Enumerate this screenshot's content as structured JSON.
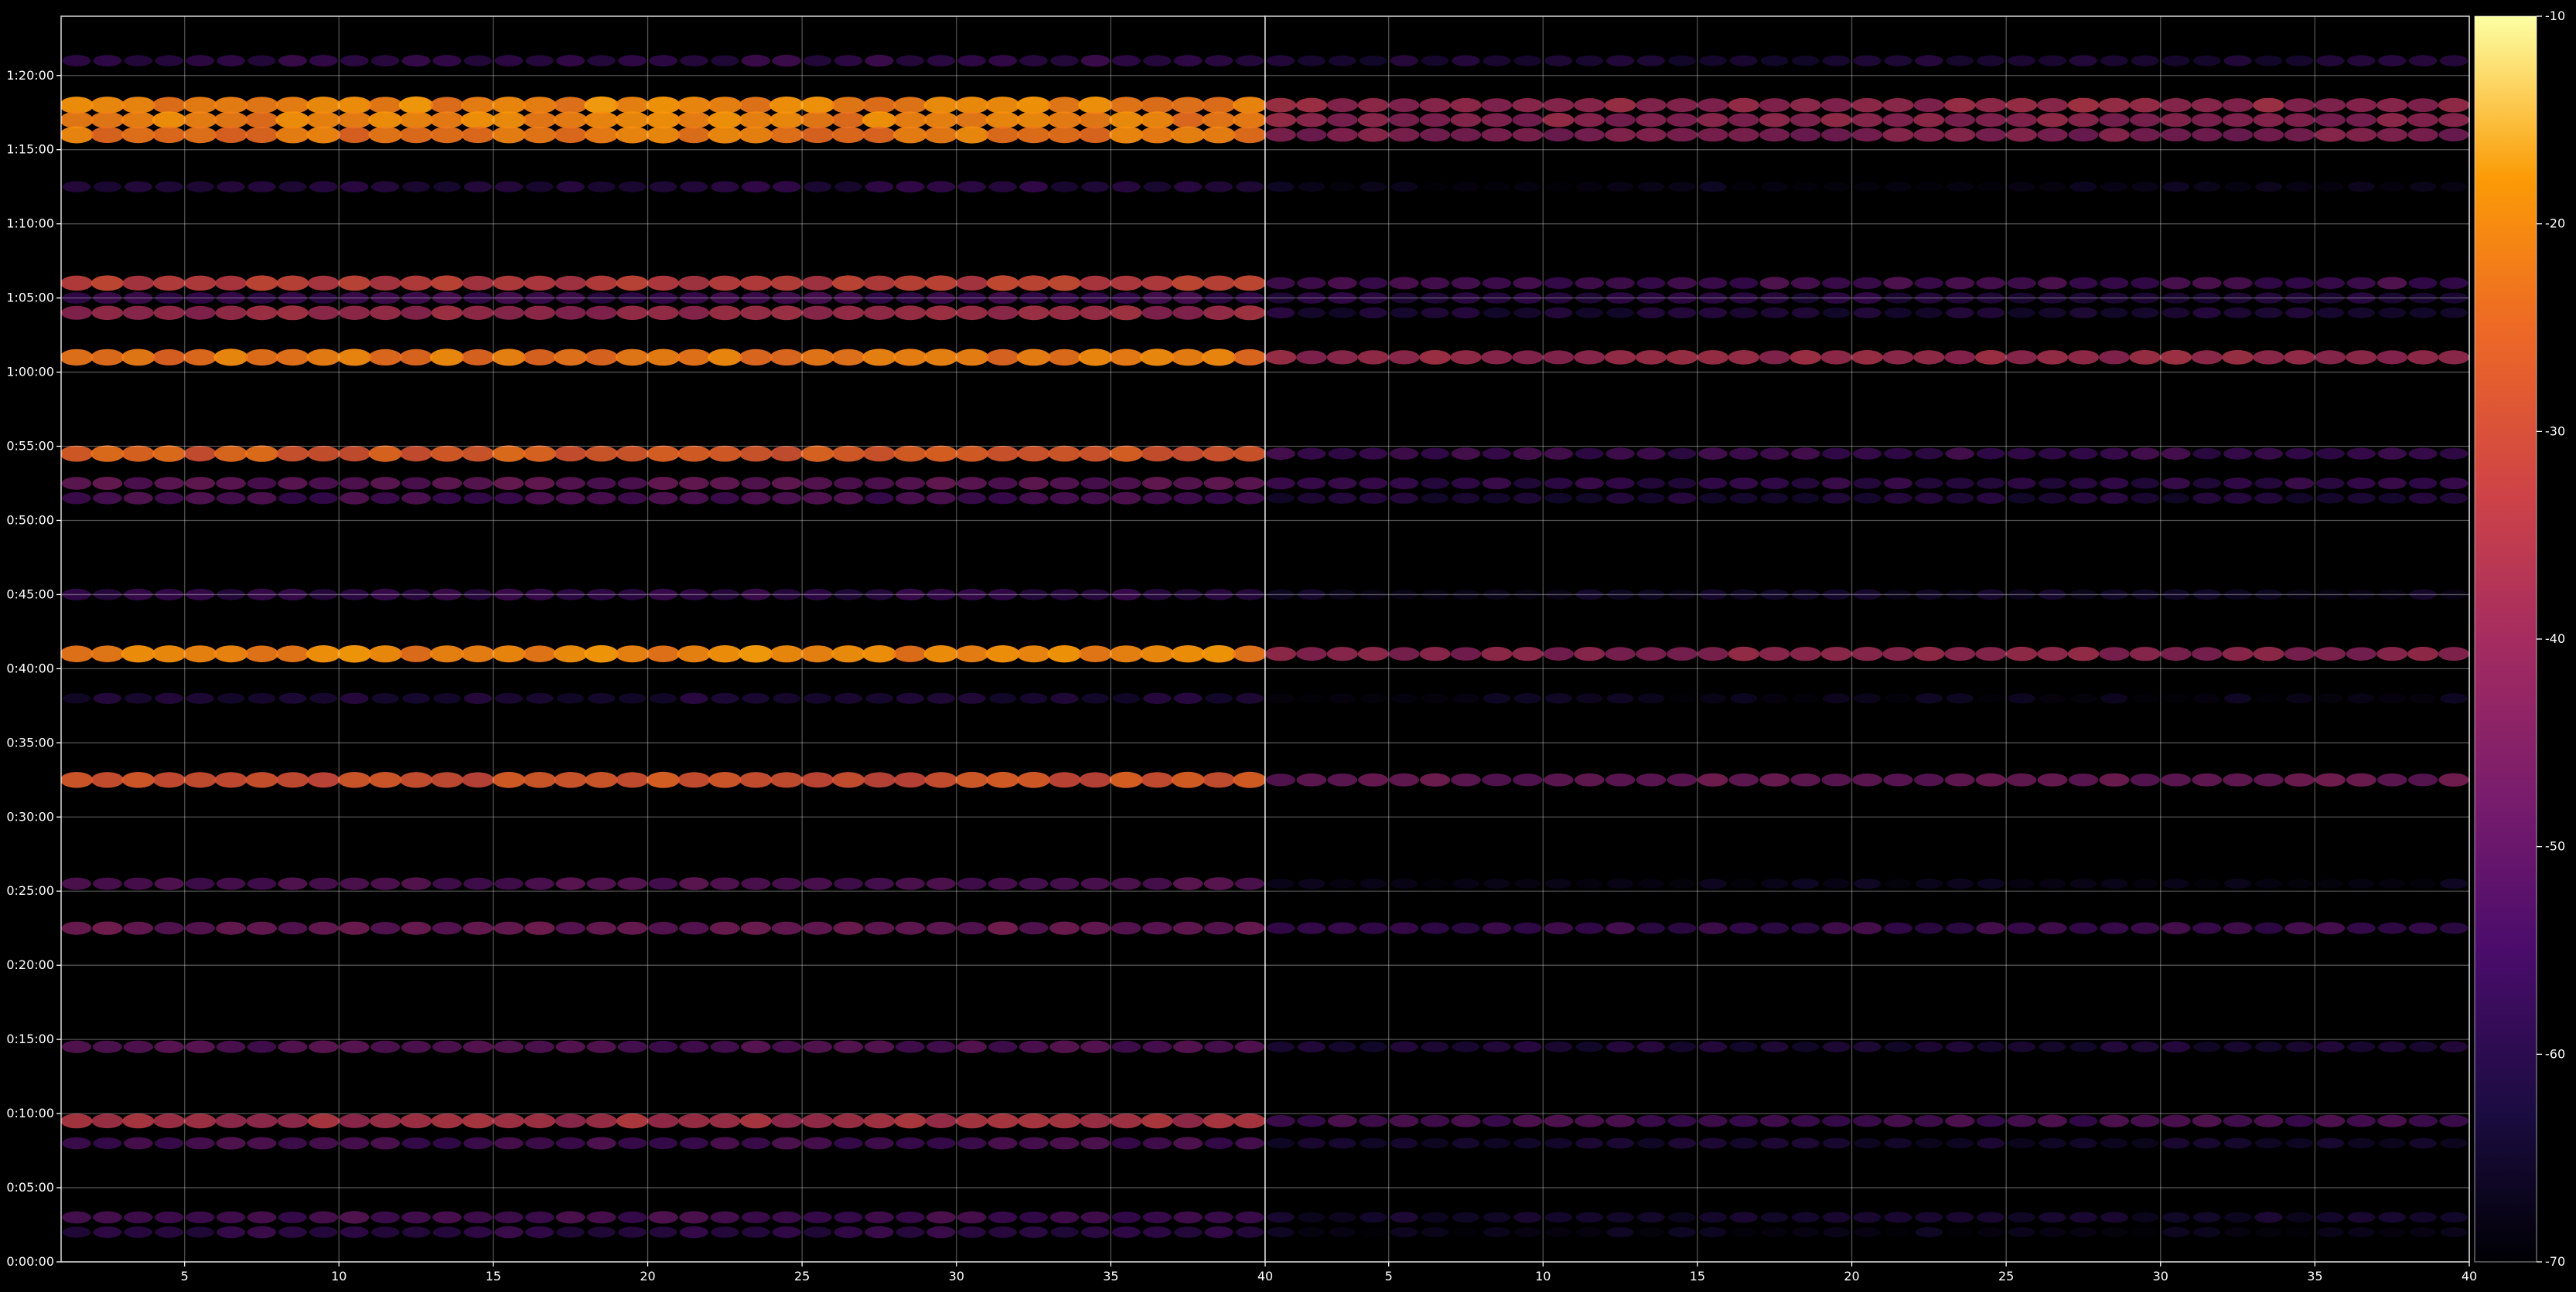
{
  "chart_data": {
    "type": "heatmap",
    "title": "",
    "xlabel": "",
    "ylabel": "",
    "colormap": "inferno",
    "background_color": "#000000",
    "grid": true,
    "panels": [
      {
        "name": "",
        "xlim": [
          1,
          40
        ],
        "x_ticks": [
          "5",
          "10",
          "15",
          "20",
          "25",
          "30",
          "35",
          "40"
        ]
      },
      {
        "name": "",
        "xlim": [
          1,
          40
        ],
        "x_ticks": [
          "5",
          "10",
          "15",
          "20",
          "25",
          "30",
          "35",
          "40"
        ]
      }
    ],
    "y_axis": {
      "ylim_seconds": [
        0,
        5040
      ],
      "ticks": [
        "0:00:00",
        "0:05:00",
        "0:10:00",
        "0:15:00",
        "0:20:00",
        "0:25:00",
        "0:30:00",
        "0:35:00",
        "0:40:00",
        "0:45:00",
        "0:50:00",
        "0:55:00",
        "1:00:00",
        "1:05:00",
        "1:10:00",
        "1:15:00",
        "1:20:00"
      ]
    },
    "colorbar": {
      "range": [
        -70,
        -10
      ],
      "ticks": [
        "-70",
        "-60",
        "-50",
        "-40",
        "-30",
        "-20",
        "-10"
      ]
    },
    "bands_approx": [
      {
        "time": "1:21:00",
        "left_level": -56,
        "right_level": -60
      },
      {
        "time": "1:18:00",
        "left_level": -20,
        "right_level": -38
      },
      {
        "time": "1:17:00",
        "left_level": -21,
        "right_level": -40
      },
      {
        "time": "1:16:00",
        "left_level": -22,
        "right_level": -42
      },
      {
        "time": "1:12:30",
        "left_level": -58,
        "right_level": -66
      },
      {
        "time": "1:06:00",
        "left_level": -32,
        "right_level": -52
      },
      {
        "time": "1:05:00",
        "left_level": -54,
        "right_level": -58
      },
      {
        "time": "1:04:00",
        "left_level": -38,
        "right_level": -60
      },
      {
        "time": "1:01:00",
        "left_level": -22,
        "right_level": -38
      },
      {
        "time": "0:54:30",
        "left_level": -26,
        "right_level": -54
      },
      {
        "time": "0:52:30",
        "left_level": -48,
        "right_level": -56
      },
      {
        "time": "0:51:30",
        "left_level": -52,
        "right_level": -60
      },
      {
        "time": "0:45:00",
        "left_level": -56,
        "right_level": -64
      },
      {
        "time": "0:41:00",
        "left_level": -20,
        "right_level": -40
      },
      {
        "time": "0:38:00",
        "left_level": -60,
        "right_level": -66
      },
      {
        "time": "0:32:30",
        "left_level": -28,
        "right_level": -46
      },
      {
        "time": "0:25:30",
        "left_level": -50,
        "right_level": -66
      },
      {
        "time": "0:22:30",
        "left_level": -46,
        "right_level": -54
      },
      {
        "time": "0:14:30",
        "left_level": -50,
        "right_level": -60
      },
      {
        "time": "0:09:30",
        "left_level": -36,
        "right_level": -52
      },
      {
        "time": "0:08:00",
        "left_level": -52,
        "right_level": -62
      },
      {
        "time": "0:03:00",
        "left_level": -52,
        "right_level": -62
      },
      {
        "time": "0:02:00",
        "left_level": -56,
        "right_level": -66
      }
    ]
  }
}
